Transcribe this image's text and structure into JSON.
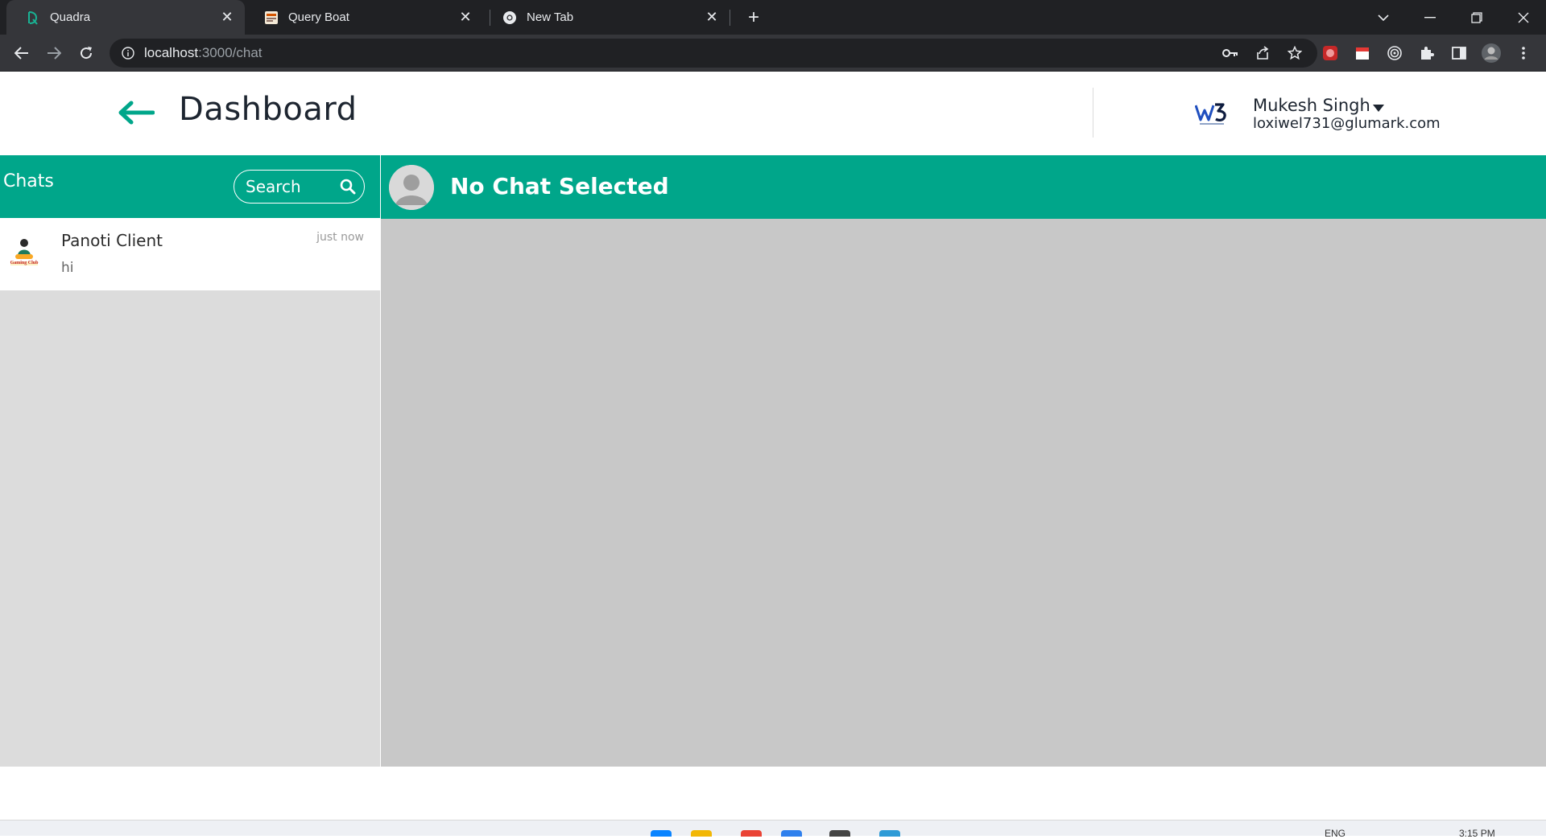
{
  "browser": {
    "tabs": [
      {
        "title": "Quadra",
        "active": true
      },
      {
        "title": "Query Boat",
        "active": false
      },
      {
        "title": "New Tab",
        "active": false
      }
    ],
    "url_host": "localhost",
    "url_path": ":3000/chat"
  },
  "header": {
    "title": "Dashboard",
    "user_name": "Mukesh Singh",
    "user_email": "loxiwel731@glumark.com"
  },
  "chats": {
    "title": "Chats",
    "search_placeholder": "Search",
    "items": [
      {
        "name": "Panoti Client",
        "preview": "hi",
        "time": "just now",
        "avatar_text": "Gaming Club"
      }
    ]
  },
  "conversation": {
    "title": "No Chat Selected"
  },
  "taskbar": {
    "lang": "ENG",
    "time": "3:15 PM"
  },
  "colors": {
    "accent": "#00a68a",
    "pane_left": "#dcdcdc",
    "pane_right": "#c8c8c8"
  }
}
